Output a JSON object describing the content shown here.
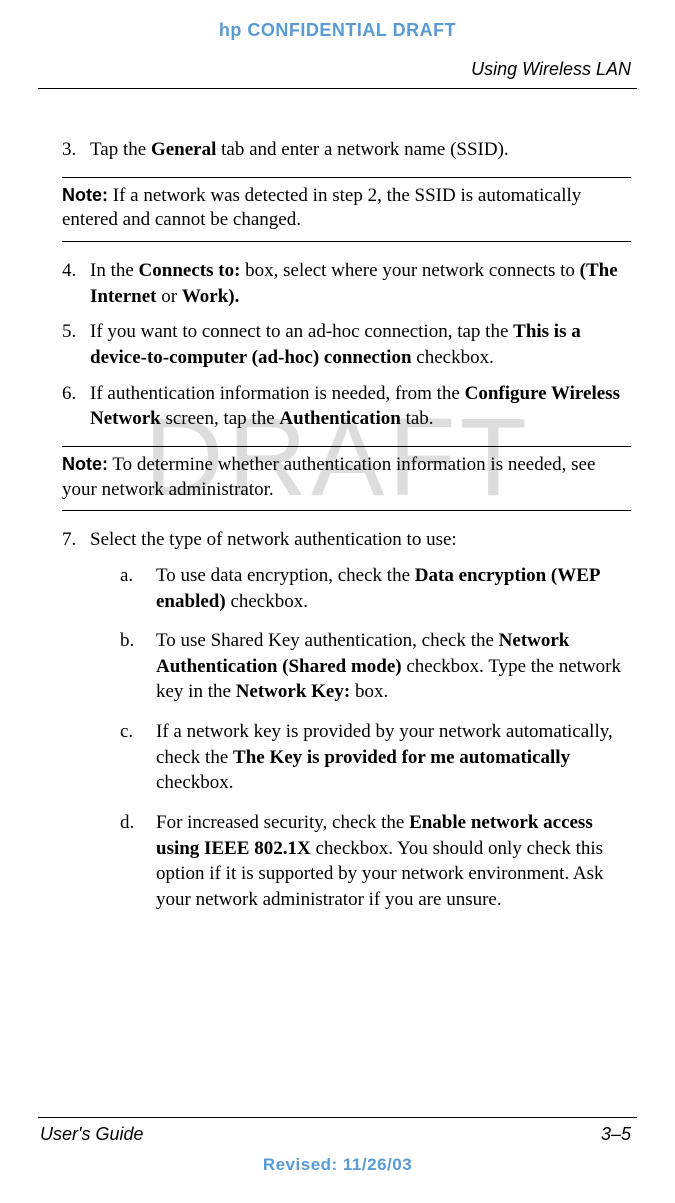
{
  "header": {
    "confidential": "hp CONFIDENTIAL DRAFT",
    "section": "Using Wireless LAN"
  },
  "watermark": "DRAFT",
  "steps": {
    "s3": {
      "num": "3.",
      "pre": "Tap the ",
      "bold": "General",
      "post": " tab and enter a network name (SSID)."
    },
    "note1": {
      "label": "Note:",
      "text": " If a network was detected in step 2, the SSID is automatically entered and cannot be changed."
    },
    "s4": {
      "num": "4.",
      "pre": "In the ",
      "b1": "Connects to:",
      "mid": " box, select where your network connects to ",
      "b2": "(The Internet",
      "or": " or ",
      "b3": "Work)."
    },
    "s5": {
      "num": "5.",
      "pre": "If you want to connect to an ad-hoc connection, tap the ",
      "bold": "This is a device-to-computer (ad-hoc) connection",
      "post": " checkbox."
    },
    "s6": {
      "num": "6.",
      "pre": "If authentication information is needed, from the ",
      "b1": "Configure Wireless Network",
      "mid": " screen, tap the ",
      "b2": "Authentication",
      "post": " tab."
    },
    "note2": {
      "label": "Note:",
      "text": " To determine whether authentication information is needed, see your network administrator."
    },
    "s7": {
      "num": "7.",
      "text": "Select the type of network authentication to use:",
      "a": {
        "letter": "a.",
        "pre": "To use data encryption, check the ",
        "bold": "Data encryption (WEP enabled)",
        "post": " checkbox."
      },
      "b": {
        "letter": "b.",
        "pre": "To use Shared Key authentication, check the ",
        "b1": "Network Authentication (Shared mode)",
        "mid": " checkbox. Type the network key in the ",
        "b2": "Network Key:",
        "post": " box."
      },
      "c": {
        "letter": "c.",
        "pre": "If a network key is provided by your network automatically, check the ",
        "bold": "The Key is provided for me automatically",
        "post": " checkbox."
      },
      "d": {
        "letter": "d.",
        "pre": "For increased security, check the ",
        "bold": "Enable network access using IEEE 802.1X",
        "post": " checkbox. You should only check this option if it is supported by your network environment. Ask your network administrator if you are unsure."
      }
    }
  },
  "footer": {
    "left": "User's Guide",
    "right": "3–5",
    "revised": "Revised: 11/26/03"
  }
}
